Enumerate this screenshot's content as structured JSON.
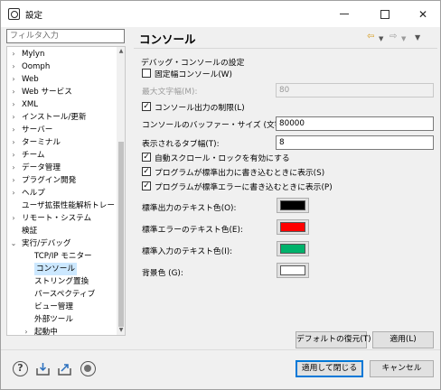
{
  "window": {
    "title": "設定"
  },
  "filter": {
    "placeholder": "フィルタ入力"
  },
  "tree": {
    "items": [
      {
        "label": "Mylyn",
        "expander": ">"
      },
      {
        "label": "Oomph",
        "expander": ">"
      },
      {
        "label": "Web",
        "expander": ">"
      },
      {
        "label": "Web サービス",
        "expander": ">"
      },
      {
        "label": "XML",
        "expander": ">"
      },
      {
        "label": "インストール/更新",
        "expander": ">"
      },
      {
        "label": "サーバー",
        "expander": ">"
      },
      {
        "label": "ターミナル",
        "expander": ">"
      },
      {
        "label": "チーム",
        "expander": ">"
      },
      {
        "label": "データ管理",
        "expander": ">"
      },
      {
        "label": "プラグイン開発",
        "expander": ">"
      },
      {
        "label": "ヘルプ",
        "expander": ">"
      },
      {
        "label": "ユーザ拡張性能解析トレー",
        "expander": ""
      },
      {
        "label": "リモート・システム",
        "expander": ">"
      },
      {
        "label": "検証",
        "expander": ""
      },
      {
        "label": "実行/デバッグ",
        "expander": "v"
      },
      {
        "label": "TCP/IP モニター",
        "expander": ""
      },
      {
        "label": "コンソール",
        "expander": "",
        "selected": true
      },
      {
        "label": "ストリング置換",
        "expander": ""
      },
      {
        "label": "パースペクティブ",
        "expander": ""
      },
      {
        "label": "ビュー管理",
        "expander": ""
      },
      {
        "label": "外部ツール",
        "expander": ""
      },
      {
        "label": "起動中",
        "expander": ">"
      }
    ]
  },
  "page": {
    "title": "コンソール",
    "section_label": "デバッグ・コンソールの設定",
    "fixed_width": {
      "label": "固定幅コンソール(W)",
      "checked": false
    },
    "max_chars": {
      "label": "最大文字幅(M):",
      "value": "80"
    },
    "limit_output": {
      "label": "コンソール出力の制限(L)",
      "checked": true
    },
    "buffer_size": {
      "label": "コンソールのバッファー・サイズ (文字)(B):",
      "value": "80000"
    },
    "tab_width": {
      "label": "表示されるタブ幅(T):",
      "value": "8"
    },
    "auto_scroll": {
      "label": "自動スクロール・ロックを有効にする",
      "checked": true
    },
    "show_stdout": {
      "label": "プログラムが標準出力に書き込むときに表示(S)",
      "checked": true
    },
    "show_stderr": {
      "label": "プログラムが標準エラーに書き込むときに表示(P)",
      "checked": true
    },
    "stdout_color": {
      "label": "標準出力のテキスト色(O):",
      "color": "#000000"
    },
    "stderr_color": {
      "label": "標準エラーのテキスト色(E):",
      "color": "#ff0000"
    },
    "stdin_color": {
      "label": "標準入力のテキスト色(I):",
      "color": "#00b26b"
    },
    "bg_color": {
      "label": "背景色 (G):",
      "color": "#ffffff"
    },
    "restore_defaults": "デフォルトの復元(T)",
    "apply": "適用(L)"
  },
  "footer": {
    "apply_and_close": "適用して閉じる",
    "cancel": "キャンセル"
  }
}
